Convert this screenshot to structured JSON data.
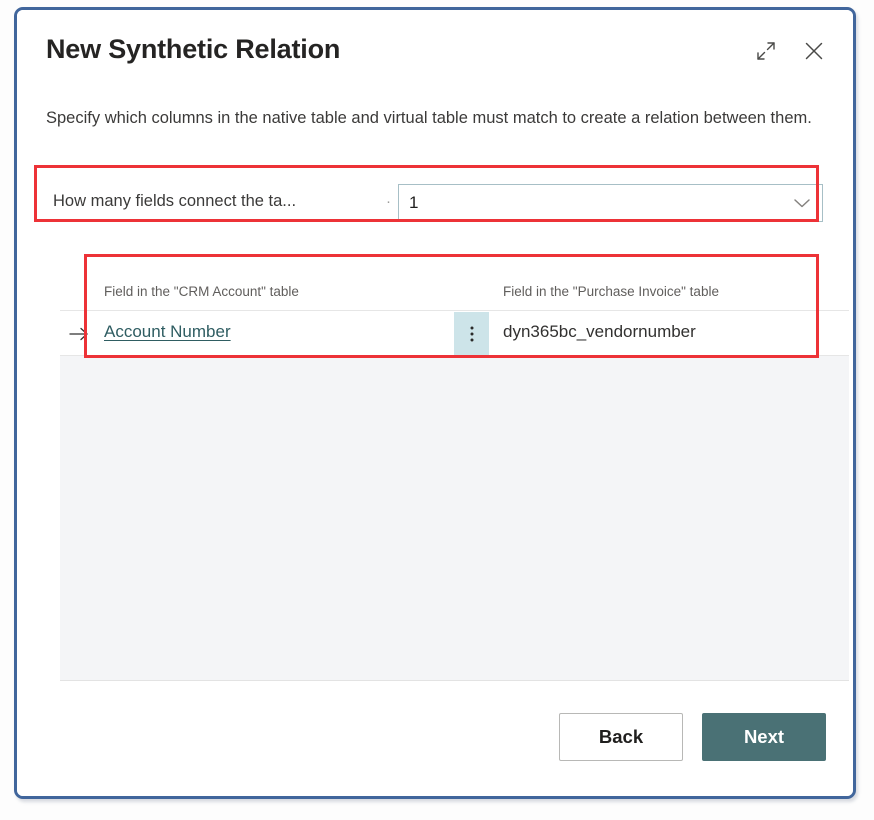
{
  "dialog": {
    "title": "New Synthetic Relation",
    "description": "Specify which columns in the native table and virtual table must match to create a relation between them.",
    "expand_icon": "expand-diagonal-icon",
    "close_icon": "close-icon"
  },
  "field_count": {
    "label": "How many fields connect the ta...",
    "separator": "·",
    "value": "1",
    "chevron_icon": "chevron-down-icon"
  },
  "mapping_grid": {
    "columns": [
      "Field in the \"CRM Account\" table",
      "Field in the \"Purchase Invoice\" table"
    ],
    "rows": [
      {
        "indicator": "→",
        "native_field": "Account Number",
        "menu_icon": "vertical-ellipsis-icon",
        "virtual_field": "dyn365bc_vendornumber"
      }
    ]
  },
  "footer": {
    "back_label": "Back",
    "next_label": "Next"
  },
  "colors": {
    "accent_teal": "#4a7175",
    "annotation_red": "#ed3237",
    "frame_blue": "#41669c",
    "dots_cell_blue": "#cde4e9",
    "link_teal": "#2f5d62"
  }
}
